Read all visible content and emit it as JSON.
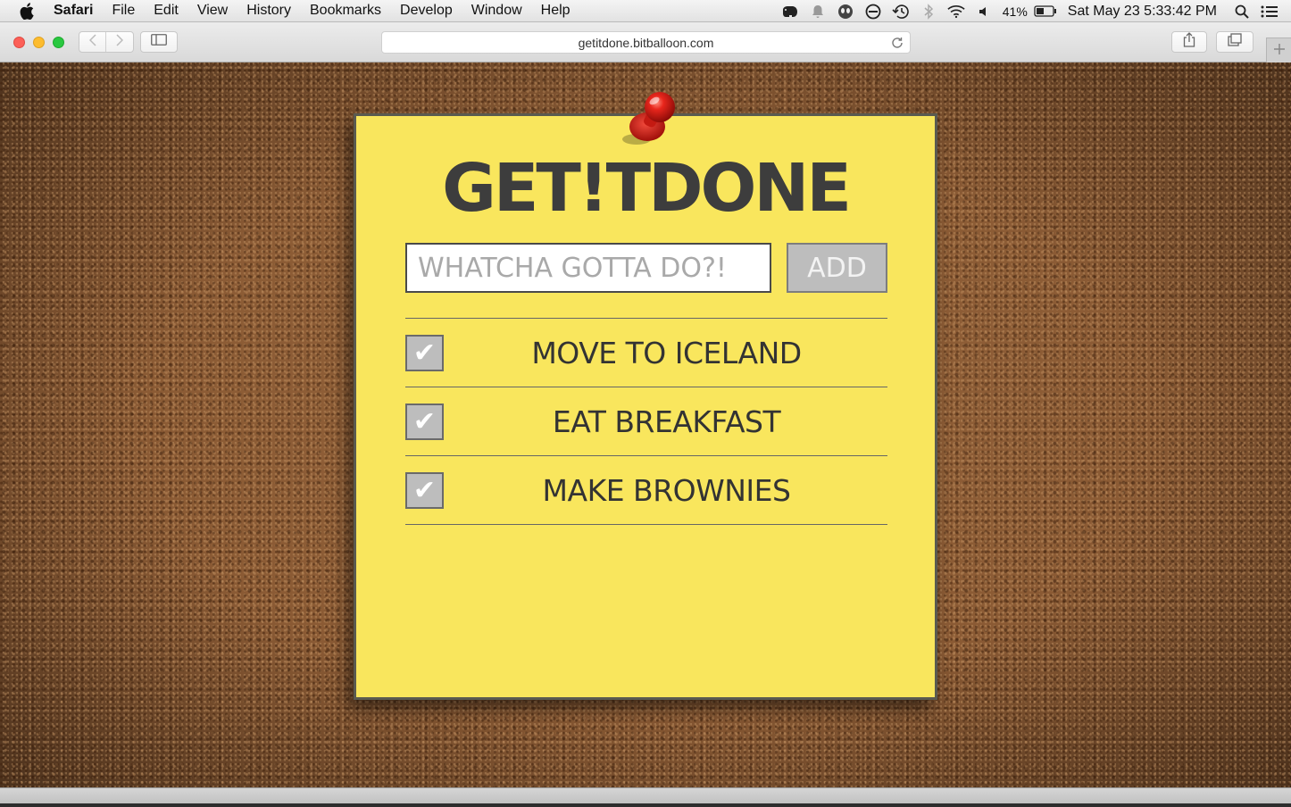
{
  "menubar": {
    "app_name": "Safari",
    "items": [
      "File",
      "Edit",
      "View",
      "History",
      "Bookmarks",
      "Develop",
      "Window",
      "Help"
    ],
    "battery_percent": "41%",
    "clock": "Sat May 23  5:33:42 PM"
  },
  "toolbar": {
    "url": "getitdone.bitballoon.com"
  },
  "app": {
    "title": "GET!TDONE",
    "input_placeholder": "WHATCHA GOTTA DO?!",
    "input_value": "",
    "add_label": "ADD",
    "todos": [
      {
        "text": "MOVE TO ICELAND",
        "check": "✔"
      },
      {
        "text": "EAT BREAKFAST",
        "check": "✔"
      },
      {
        "text": "MAKE BROWNIES",
        "check": "✔"
      }
    ]
  },
  "colors": {
    "note": "#f9e65d",
    "cork": "#8a5a34",
    "title_text": "#3d3d3d",
    "button_gray": "#bdbdbd",
    "pin_red": "#d81e16"
  },
  "icons": {
    "menubar": [
      "apple-icon",
      "evernote-icon",
      "notification-icon",
      "alien-icon",
      "no-entry-icon",
      "time-machine-icon",
      "bluetooth-icon",
      "wifi-icon",
      "volume-icon",
      "battery-icon",
      "spotlight-icon",
      "notification-center-icon"
    ],
    "toolbar": [
      "back-icon",
      "forward-icon",
      "sidebar-icon",
      "reload-icon",
      "share-icon",
      "tabs-icon",
      "plus-icon"
    ],
    "page": [
      "pushpin-icon",
      "checkmark-icon"
    ]
  }
}
